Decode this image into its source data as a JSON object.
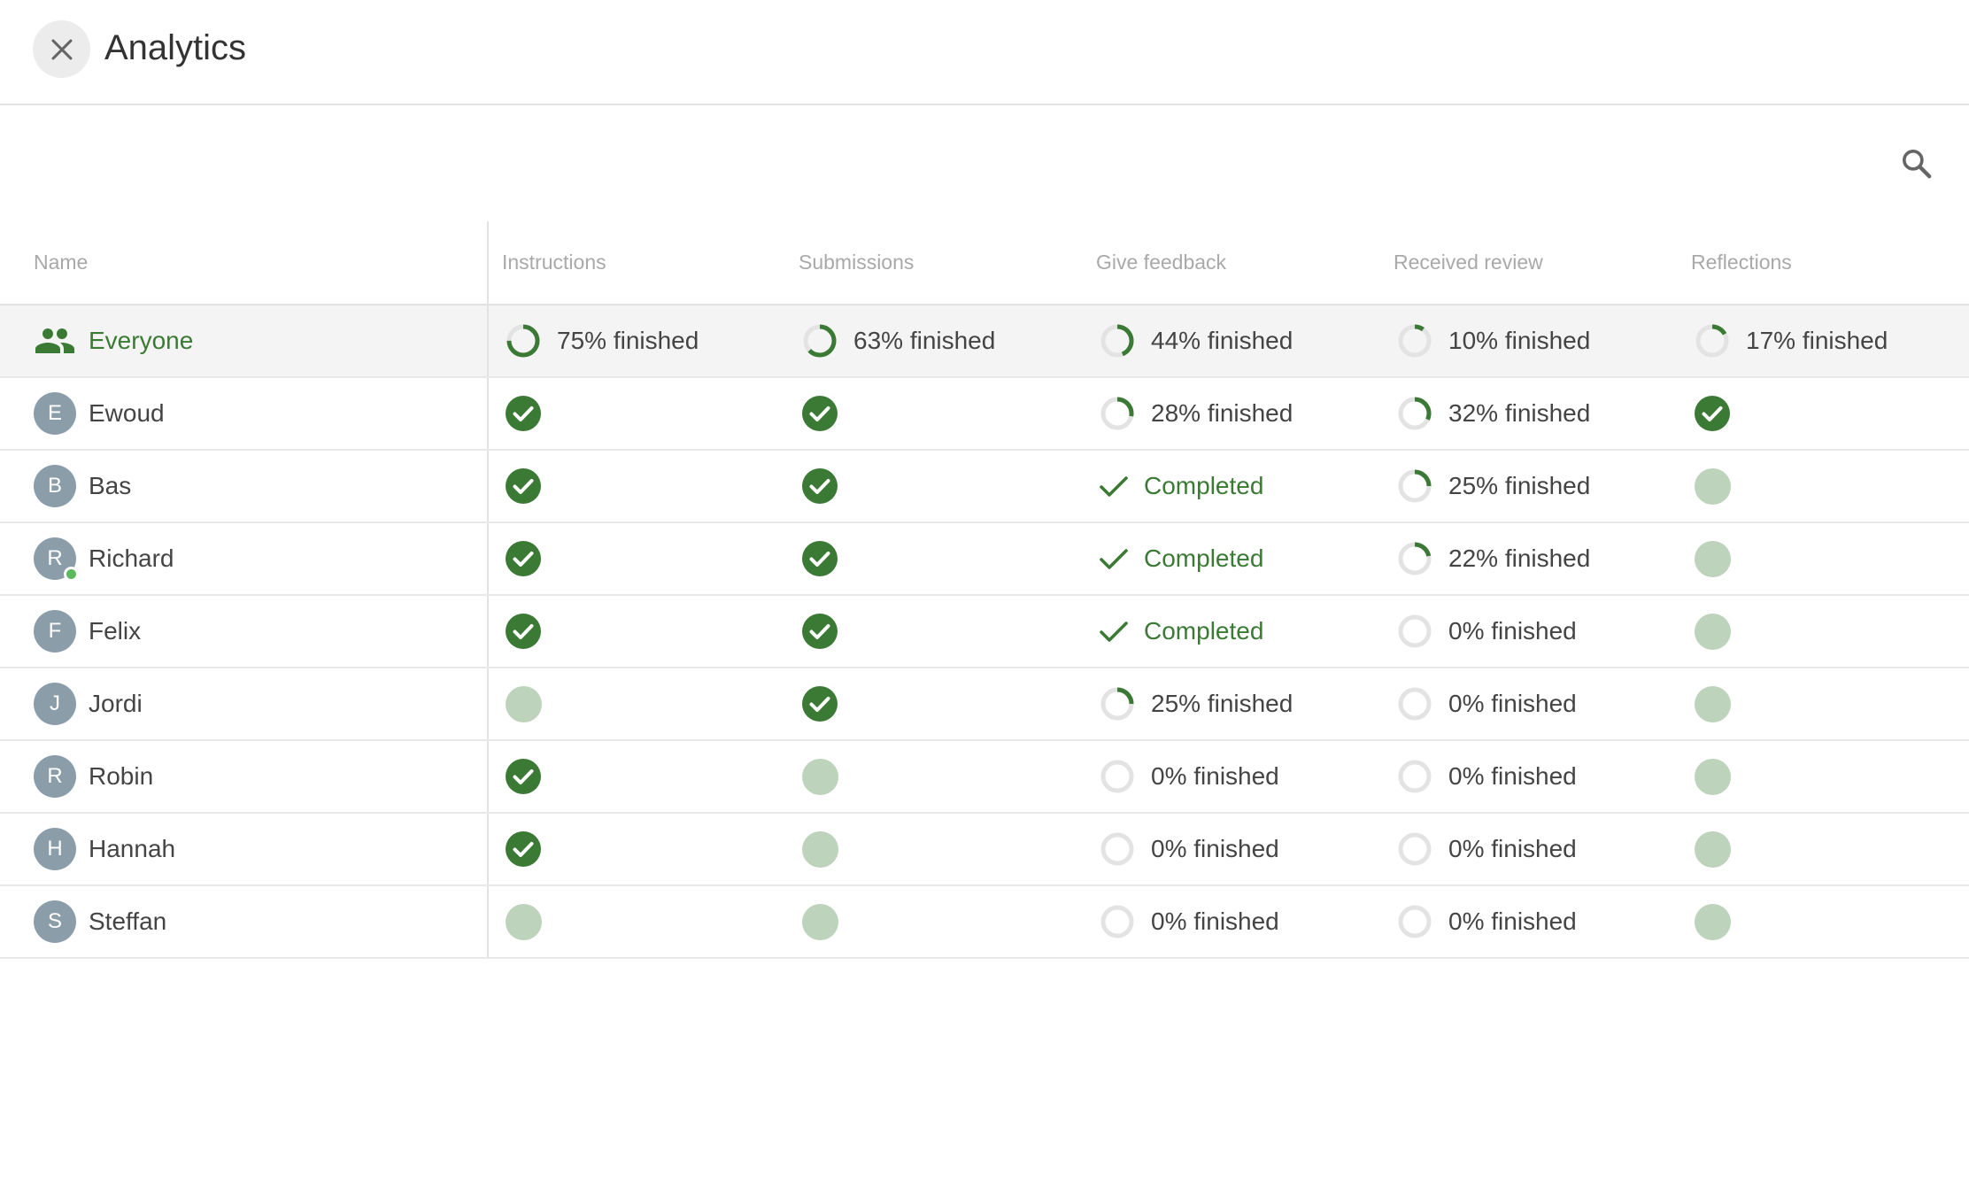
{
  "header": {
    "title": "Analytics"
  },
  "icons": {
    "close": "close-icon",
    "search": "search-icon",
    "group": "people-icon"
  },
  "colors": {
    "accent": "#3b7a34",
    "pending": "#bed3bb",
    "ring_track": "#e3e3e3",
    "avatar": "#8c9daa",
    "online": "#5cb85c"
  },
  "table": {
    "columns": [
      "Name",
      "Instructions",
      "Submissions",
      "Give feedback",
      "Received review",
      "Reflections"
    ],
    "rows": [
      {
        "name": "Everyone",
        "type": "group",
        "cells": [
          {
            "type": "progress",
            "value": 75,
            "text": "75% finished"
          },
          {
            "type": "progress",
            "value": 63,
            "text": "63% finished"
          },
          {
            "type": "progress",
            "value": 44,
            "text": "44% finished"
          },
          {
            "type": "progress",
            "value": 10,
            "text": "10% finished"
          },
          {
            "type": "progress",
            "value": 17,
            "text": "17% finished"
          }
        ]
      },
      {
        "name": "Ewoud",
        "initial": "E",
        "cells": [
          {
            "type": "done"
          },
          {
            "type": "done"
          },
          {
            "type": "progress",
            "value": 28,
            "text": "28% finished"
          },
          {
            "type": "progress",
            "value": 32,
            "text": "32% finished"
          },
          {
            "type": "done"
          }
        ]
      },
      {
        "name": "Bas",
        "initial": "B",
        "cells": [
          {
            "type": "done"
          },
          {
            "type": "done"
          },
          {
            "type": "completed",
            "text": "Completed"
          },
          {
            "type": "progress",
            "value": 25,
            "text": "25% finished"
          },
          {
            "type": "pending"
          }
        ]
      },
      {
        "name": "Richard",
        "initial": "R",
        "online": true,
        "cells": [
          {
            "type": "done"
          },
          {
            "type": "done"
          },
          {
            "type": "completed",
            "text": "Completed"
          },
          {
            "type": "progress",
            "value": 22,
            "text": "22% finished"
          },
          {
            "type": "pending"
          }
        ]
      },
      {
        "name": "Felix",
        "initial": "F",
        "cells": [
          {
            "type": "done"
          },
          {
            "type": "done"
          },
          {
            "type": "completed",
            "text": "Completed"
          },
          {
            "type": "progress",
            "value": 0,
            "text": "0% finished"
          },
          {
            "type": "pending"
          }
        ]
      },
      {
        "name": "Jordi",
        "initial": "J",
        "cells": [
          {
            "type": "pending"
          },
          {
            "type": "done"
          },
          {
            "type": "progress",
            "value": 25,
            "text": "25% finished"
          },
          {
            "type": "progress",
            "value": 0,
            "text": "0% finished"
          },
          {
            "type": "pending"
          }
        ]
      },
      {
        "name": "Robin",
        "initial": "R",
        "cells": [
          {
            "type": "done"
          },
          {
            "type": "pending"
          },
          {
            "type": "progress",
            "value": 0,
            "text": "0% finished"
          },
          {
            "type": "progress",
            "value": 0,
            "text": "0% finished"
          },
          {
            "type": "pending"
          }
        ]
      },
      {
        "name": "Hannah",
        "initial": "H",
        "cells": [
          {
            "type": "done"
          },
          {
            "type": "pending"
          },
          {
            "type": "progress",
            "value": 0,
            "text": "0% finished"
          },
          {
            "type": "progress",
            "value": 0,
            "text": "0% finished"
          },
          {
            "type": "pending"
          }
        ]
      },
      {
        "name": "Steffan",
        "initial": "S",
        "cells": [
          {
            "type": "pending"
          },
          {
            "type": "pending"
          },
          {
            "type": "progress",
            "value": 0,
            "text": "0% finished"
          },
          {
            "type": "progress",
            "value": 0,
            "text": "0% finished"
          },
          {
            "type": "pending"
          }
        ]
      }
    ]
  }
}
